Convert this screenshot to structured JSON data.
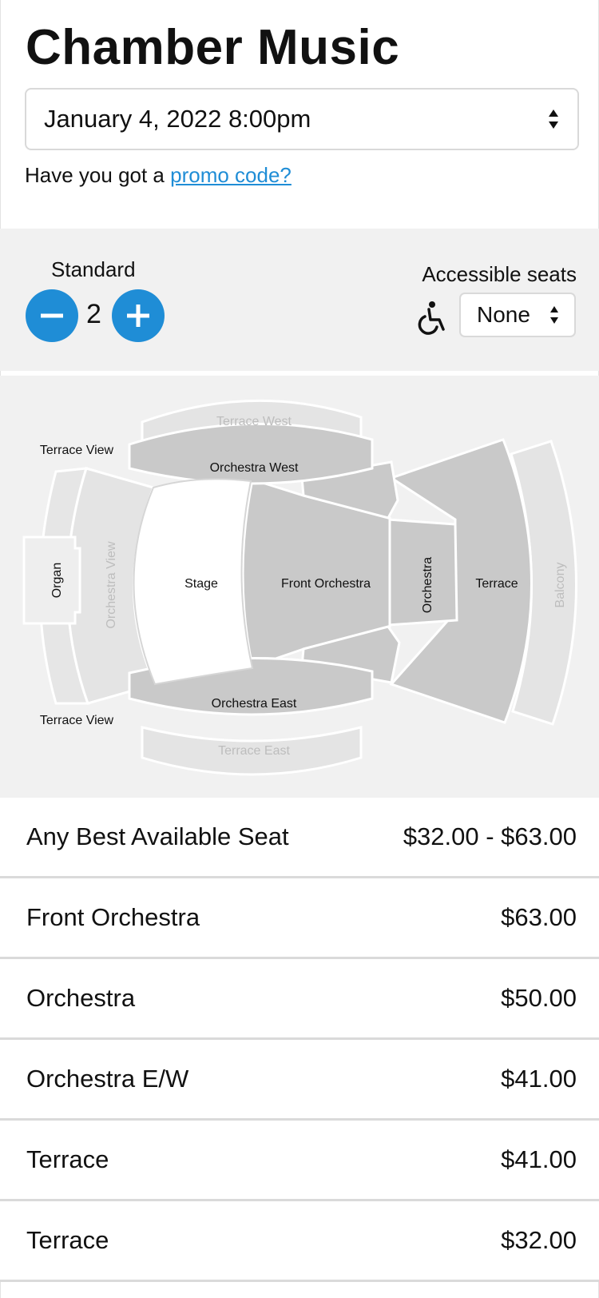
{
  "header": {
    "title": "Chamber Music"
  },
  "performance": {
    "selected": "January 4, 2022 8:00pm"
  },
  "promo": {
    "prefix": "Have you got a ",
    "link": "promo code?"
  },
  "quantity": {
    "standard_label": "Standard",
    "standard_value": "2",
    "accessible_label": "Accessible seats",
    "accessible_value": "None"
  },
  "seat_map": {
    "sections": {
      "terrace_west": "Terrace West",
      "terrace_view_top": "Terrace View",
      "orchestra_west": "Orchestra West",
      "organ": "Organ",
      "orchestra_view": "Orchestra View",
      "stage": "Stage",
      "front_orchestra": "Front Orchestra",
      "orchestra": "Orchestra",
      "terrace": "Terrace",
      "balcony": "Balcony",
      "orchestra_east": "Orchestra East",
      "terrace_view_bottom": "Terrace View",
      "terrace_east": "Terrace East"
    },
    "colors": {
      "available": "#c9c9c9",
      "unavailable": "#e4e4e4",
      "stage": "#ffffff",
      "accent": "#1f8dd6"
    }
  },
  "prices": [
    {
      "name": "Any Best Available Seat",
      "price": "$32.00 - $63.00"
    },
    {
      "name": "Front Orchestra",
      "price": "$63.00"
    },
    {
      "name": "Orchestra",
      "price": "$50.00"
    },
    {
      "name": "Orchestra E/W",
      "price": "$41.00"
    },
    {
      "name": "Terrace",
      "price": "$41.00"
    },
    {
      "name": "Terrace",
      "price": "$32.00"
    }
  ],
  "icons": [
    "chevron-updown-icon",
    "minus-icon",
    "plus-icon",
    "wheelchair-icon"
  ]
}
